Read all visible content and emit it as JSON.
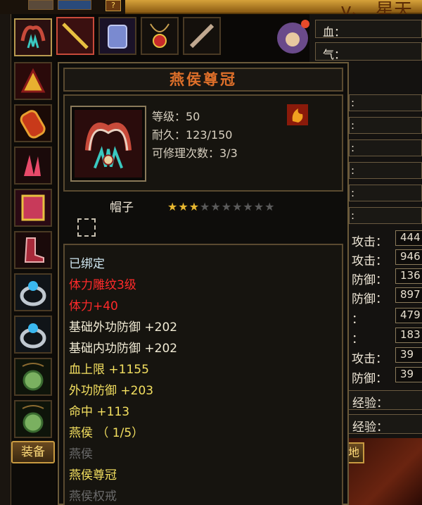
{
  "colors": {
    "bound": "#cfe6f0",
    "red": "#ff2a2a",
    "attr": "#f2ecd6",
    "green": "#d8e890",
    "yellow": "#f4e060",
    "grey": "#6a6a6a",
    "orange": "#e0702a"
  },
  "topbar": {
    "question_label": "?",
    "banner_text": "v、 星天"
  },
  "left_slots": [
    {
      "name": "helmet-slot",
      "icon": "helmet-icon"
    },
    {
      "name": "blade-slot",
      "icon": "blade-icon"
    },
    {
      "name": "bracer-slot",
      "icon": "bracer-icon"
    },
    {
      "name": "glove-slot",
      "icon": "glove-icon"
    },
    {
      "name": "belt-slot",
      "icon": "belt-icon"
    },
    {
      "name": "boots-slot",
      "icon": "boots-icon"
    },
    {
      "name": "ring1-slot",
      "icon": "ring-icon"
    },
    {
      "name": "ring2-slot",
      "icon": "ring-icon"
    },
    {
      "name": "amulet1-slot",
      "icon": "jade-pendant-icon"
    },
    {
      "name": "amulet2-slot",
      "icon": "jade-pendant-icon"
    }
  ],
  "top_slots": [
    "armor-icon",
    "necklace-icon",
    "dagger-icon"
  ],
  "equip_tab": "装备",
  "right": {
    "blood": "血：",
    "qi": "气：",
    "colons": [
      ":",
      ":",
      ":",
      ":",
      ":",
      ":"
    ],
    "stats": [
      {
        "label": "攻击：",
        "value": "444"
      },
      {
        "label": "攻击：",
        "value": "946"
      },
      {
        "label": "防御：",
        "value": "136"
      },
      {
        "label": "防御：",
        "value": "897"
      },
      {
        "label": "：",
        "value": "479"
      },
      {
        "label": "：",
        "value": "183"
      },
      {
        "label": "攻击：",
        "value": "39"
      },
      {
        "label": "防御：",
        "value": "39"
      }
    ],
    "exp1": "经验：",
    "exp2": "经验：",
    "half_btn": "地"
  },
  "tooltip": {
    "title": "燕侯尊冠",
    "level": "等级：50",
    "durability": "耐久：123/150",
    "repairs": "可修理次数：3/3",
    "type": "帽子",
    "stars_on": 3,
    "stars_total": 10,
    "lines": [
      {
        "text": "已绑定",
        "color": "bound"
      },
      {
        "text": "体力雕纹3级",
        "color": "red"
      },
      {
        "text": "体力+40",
        "color": "red"
      },
      {
        "text": "基础外功防御 +202",
        "color": "attr"
      },
      {
        "text": "基础内功防御 +202",
        "color": "attr"
      },
      {
        "text": "血上限 +1155",
        "color": "yellow"
      },
      {
        "text": "外功防御 +203",
        "color": "yellow"
      },
      {
        "text": "命中 +113",
        "color": "yellow"
      },
      {
        "text": "燕侯 （ 1/5）",
        "color": "yellow"
      },
      {
        "text": "燕侯",
        "color": "grey"
      },
      {
        "text": "燕侯尊冠",
        "color": "yellow"
      },
      {
        "text": "燕侯权戒",
        "color": "grey"
      }
    ]
  }
}
